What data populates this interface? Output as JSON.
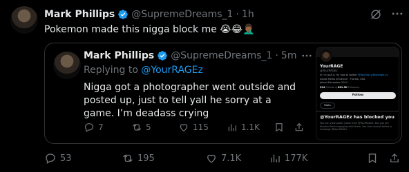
{
  "tweet": {
    "author_name": "Mark Phillips",
    "author_handle": "@SupremeDreams_1",
    "separator": "·",
    "time": "1h",
    "text": "Pokemon made this nigga block me 😭😂🤦🏾‍♂️",
    "stats": {
      "replies": "53",
      "reposts": "195",
      "likes": "7.1K",
      "views": "177K"
    }
  },
  "quoted_tweet": {
    "author_name": "Mark Phillips",
    "author_handle": "@SupremeDreams_1",
    "separator": "·",
    "time": "5m",
    "replying_prefix": "Replying to",
    "replying_to": "@YourRAGEz",
    "text": "Nigga got a photographer went outside and posted up, just to tell yall he sorry at a game. I’m deadass crying",
    "stats": {
      "replies": "7",
      "reposts": "5",
      "likes": "115",
      "views": "1.1K"
    }
  },
  "screenshot": {
    "name": "YourRAGE",
    "handle": "@YourRAGEz",
    "bio_prefix": "hi I'm josh & I'm new to twitter",
    "bio_link": "@fanmrbl.yt@gmlight.yz",
    "meta_line": "Social Media Influencer · Florida, USA",
    "joined": "Joined December 2014",
    "following_count": "394",
    "following_label": "Following",
    "followers_count": "861.5K",
    "followers_label": "Followers",
    "follow_button": "Follow",
    "posts_tab": "Posts",
    "blocked_title": "@YourRAGEz has blocked you",
    "blocked_text": "You can view public posts from @YourRAGEz, but you are blocked from engaging with them. You also cannot follow or message @YourRAGEz."
  },
  "colors": {
    "background": "#000000",
    "text_primary": "#e7e9ea",
    "text_secondary": "#71767b",
    "accent": "#1d9bf0",
    "border": "#2f3336"
  },
  "icons": [
    "verified-badge-icon",
    "grok-icon",
    "more-icon",
    "reply-icon",
    "repost-icon",
    "like-icon",
    "views-icon",
    "bookmark-icon",
    "share-icon"
  ]
}
